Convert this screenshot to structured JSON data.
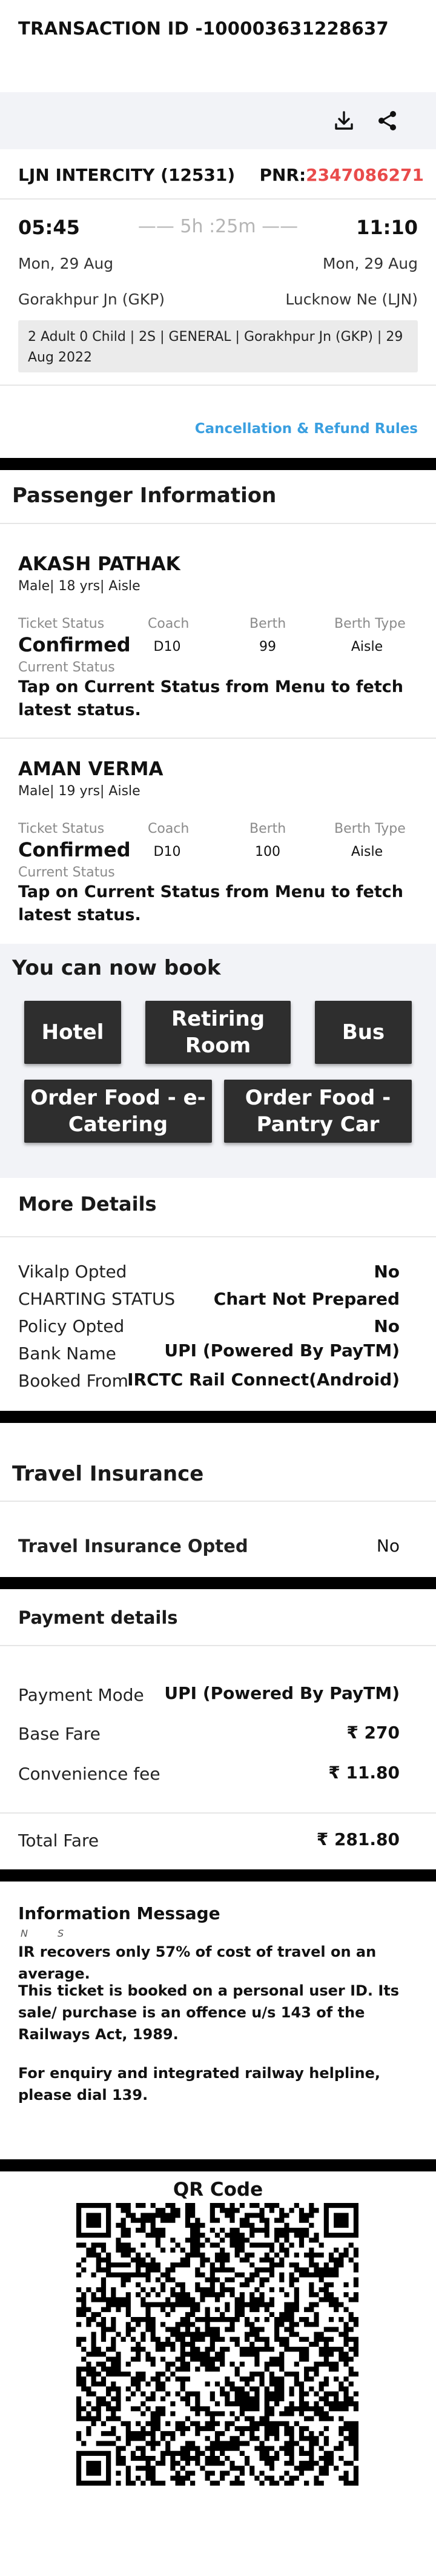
{
  "header": {
    "transaction_title": "TRANSACTION ID -100003631228637"
  },
  "actions": {
    "download_icon": "download-icon",
    "share_icon": "share-icon"
  },
  "train": {
    "name": "LJN INTERCITY (12531)",
    "pnr_label": "PNR:",
    "pnr": "2347086271",
    "depart_time": "05:45",
    "arrive_time": "11:10",
    "duration": "—— 5h :25m ——",
    "depart_date": "Mon, 29 Aug",
    "arrive_date": "Mon, 29 Aug",
    "from_station": "Gorakhpur Jn (GKP)",
    "to_station": "Lucknow Ne (LJN)",
    "summary": "2 Adult 0 Child  | 2S | GENERAL | Gorakhpur Jn (GKP) | 29 Aug 2022"
  },
  "links": {
    "cancellation": "Cancellation & Refund Rules"
  },
  "passengers": {
    "heading": "Passenger Information",
    "labels": {
      "ticket_status": "Ticket Status",
      "coach": "Coach",
      "berth": "Berth",
      "berth_type": "Berth Type",
      "current_status": "Current Status"
    },
    "list": [
      {
        "name": "AKASH PATHAK",
        "meta": "Male| 18 yrs| Aisle",
        "status": "Confirmed",
        "coach": "D10",
        "berth": "99",
        "berth_type": "Aisle",
        "current_msg": "Tap on Current Status from Menu to fetch latest status."
      },
      {
        "name": "AMAN VERMA",
        "meta": "Male| 19 yrs| Aisle",
        "status": "Confirmed",
        "coach": "D10",
        "berth": "100",
        "berth_type": "Aisle",
        "current_msg": "Tap on Current Status from Menu to fetch latest status."
      }
    ]
  },
  "book": {
    "heading": "You can now book",
    "hotel": "Hotel",
    "retiring_room": "Retiring Room",
    "bus": "Bus",
    "ecatering": "Order Food - e-Catering",
    "pantry": "Order Food - Pantry Car"
  },
  "more_details": {
    "heading": "More Details",
    "rows": [
      {
        "label": "Vikalp Opted",
        "value": "No"
      },
      {
        "label": "CHARTING STATUS",
        "value": "Chart Not Prepared"
      },
      {
        "label": "Policy Opted",
        "value": "No"
      },
      {
        "label": "Bank Name",
        "value": "UPI (Powered By PayTM)"
      },
      {
        "label": "Booked From",
        "value": "IRCTC Rail Connect(Android)"
      }
    ]
  },
  "insurance": {
    "heading": "Travel Insurance",
    "label": "Travel Insurance Opted",
    "value": "No"
  },
  "payment": {
    "heading": "Payment details",
    "mode_label": "Payment Mode",
    "mode_value": "UPI (Powered By PayTM)",
    "base_label": "Base Fare",
    "base_value": "₹ 270",
    "conv_label": "Convenience fee",
    "conv_value": "₹  11.80",
    "total_label": "Total Fare",
    "total_value": "₹ 281.80"
  },
  "info": {
    "heading": "Information Message",
    "tiny": "N S",
    "p1": "IR recovers only 57% of cost of travel on an average.",
    "p2": "This ticket is booked on a personal user ID. Its sale/ purchase is an offence u/s 143 of the Railways Act, 1989.",
    "p3": "For enquiry and integrated railway helpline, please dial 139."
  },
  "qr": {
    "title": "QR Code"
  },
  "colors": {
    "pnr": "#e94b4b",
    "link": "#3a9fe0",
    "button_bg": "#2e2e2e",
    "panel_bg": "#f2f3f7"
  }
}
